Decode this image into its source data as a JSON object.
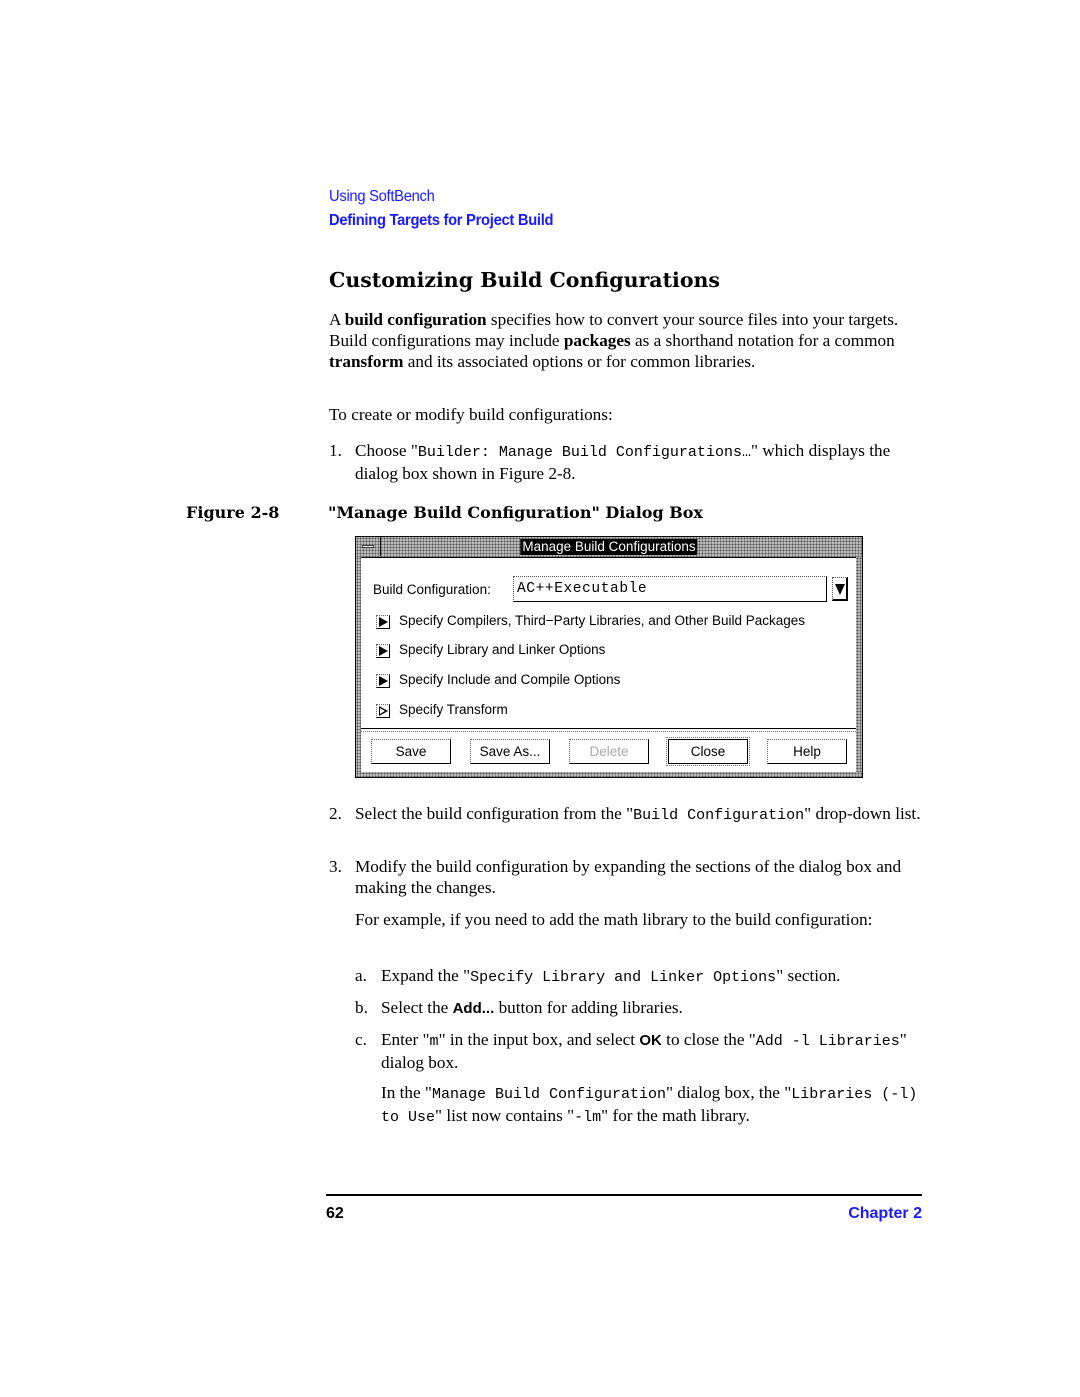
{
  "header": {
    "section": "Using SoftBench",
    "subsection": "Defining Targets for Project Build"
  },
  "heading": "Customizing Build Configurations",
  "intro": {
    "t1": "A ",
    "b1": "build configuration",
    "t2": " specifies how to convert your source files into your targets. Build configurations may include ",
    "b2": "packages",
    "t3": " as a shorthand notation for a common ",
    "b3": "transform",
    "t4": " and its associated options or for common libraries."
  },
  "lead_in": "To create or modify build configurations:",
  "step1": {
    "num": "1.",
    "t1": "Choose \"",
    "code": "Builder: Manage Build Configurations…",
    "t2": "\" which displays the dialog box shown in Figure 2-8."
  },
  "figure": {
    "number": "Figure 2-8",
    "title": "\"Manage Build Configuration\" Dialog Box"
  },
  "dialog": {
    "title": "Manage Build Configurations",
    "config_label": "Build Configuration:",
    "config_value": "AC++Executable",
    "sections": [
      {
        "label": "Specify Compilers, Third−Party Libraries, and Other Build Packages",
        "state": "collapsed"
      },
      {
        "label": "Specify Library and Linker Options",
        "state": "collapsed"
      },
      {
        "label": "Specify Include and Compile Options",
        "state": "collapsed"
      },
      {
        "label": "Specify Transform",
        "state": "collapsed-empty"
      }
    ],
    "buttons": [
      {
        "label": "Save",
        "enabled": true
      },
      {
        "label": "Save As...",
        "enabled": true
      },
      {
        "label": "Delete",
        "enabled": false
      },
      {
        "label": "Close",
        "enabled": true,
        "default": true
      },
      {
        "label": "Help",
        "enabled": true
      }
    ]
  },
  "step2": {
    "num": "2.",
    "t1": "Select the build configuration from the \"",
    "code": "Build Configuration",
    "t2": "\" drop-down list."
  },
  "step3": {
    "num": "3.",
    "text": "Modify the build configuration by expanding the sections of the dialog box and making the changes."
  },
  "example": "For example, if you need to add the math library to the build configuration:",
  "substeps": {
    "a": {
      "num": "a.",
      "t1": "Expand the \"",
      "code": "Specify Library and Linker Options",
      "t2": "\" section."
    },
    "b": {
      "num": "b.",
      "t1": "Select the ",
      "ui": "Add...",
      "t2": " button for adding libraries."
    },
    "c": {
      "num": "c.",
      "t1": "Enter \"",
      "code1": "m",
      "t2": "\" in the input box, and select ",
      "ui": "OK",
      "t3": " to close the \"",
      "code2": "Add -l Libraries",
      "t4": "\" dialog box."
    }
  },
  "result": {
    "t1": "In the \"",
    "code1": "Manage Build Configuration",
    "t2": "\" dialog box, the \"",
    "code2": "Libraries (-l) to Use",
    "t3": "\" list now contains \"",
    "code3": "-lm",
    "t4": "\" for the math library."
  },
  "footer": {
    "page": "62",
    "chapter": "Chapter 2"
  },
  "colors": {
    "link_blue": "#1a1aff"
  }
}
